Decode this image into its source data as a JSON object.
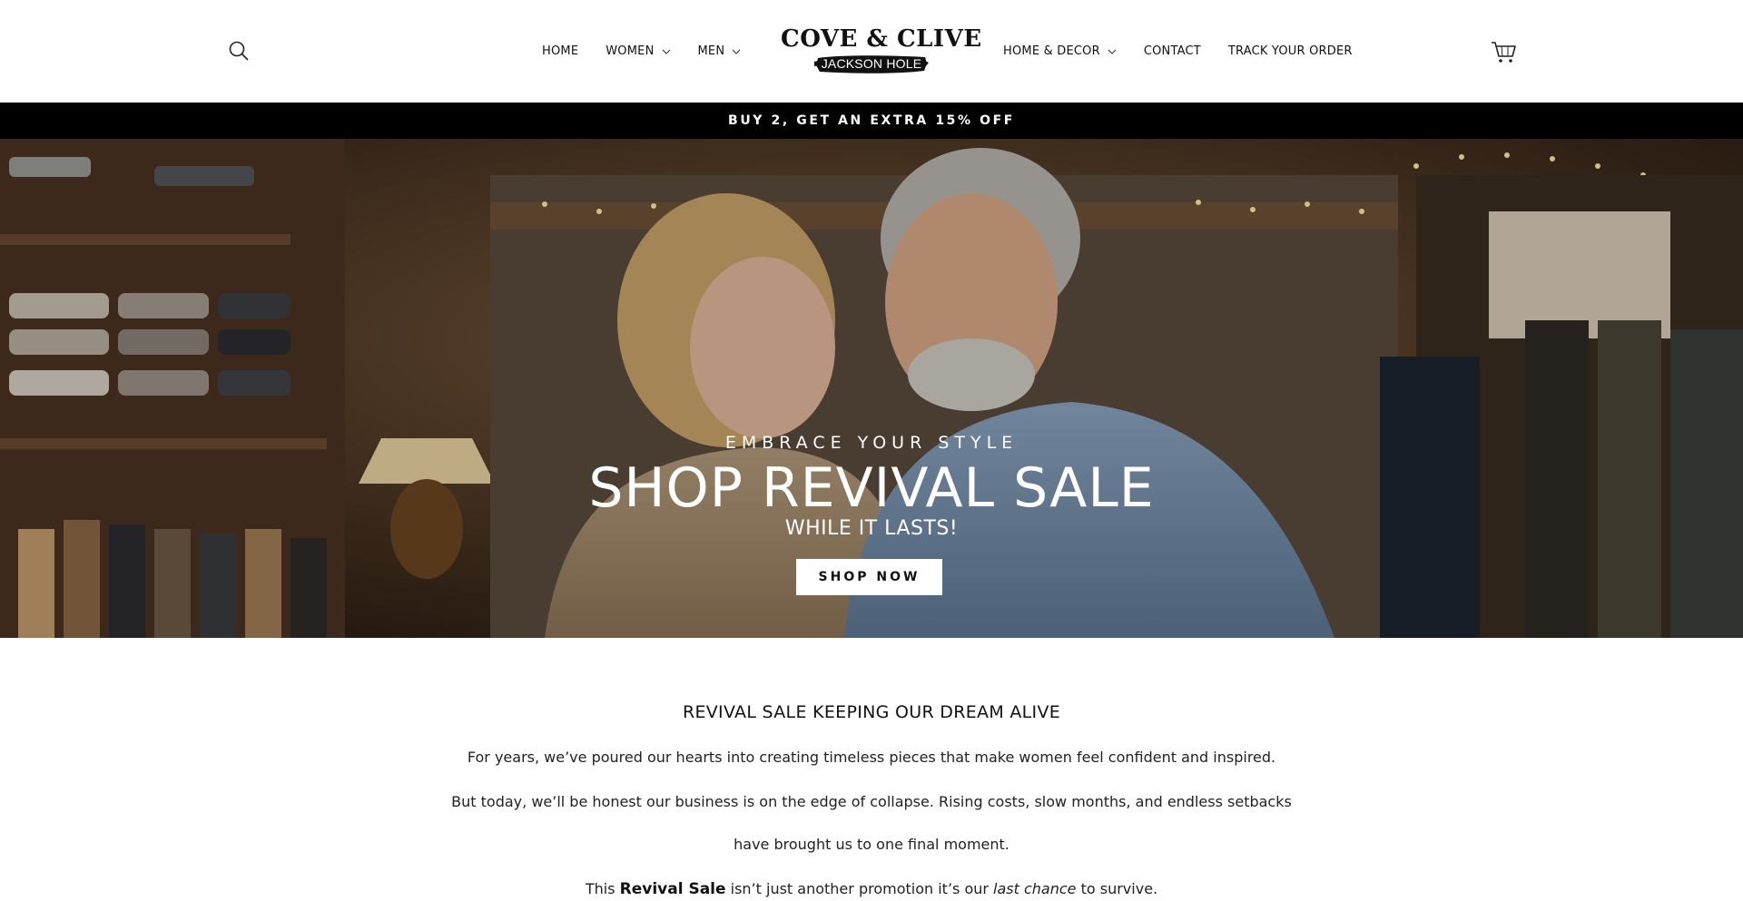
{
  "header": {
    "nav_left": [
      {
        "label": "HOME",
        "has_dropdown": false
      },
      {
        "label": "WOMEN",
        "has_dropdown": true
      },
      {
        "label": "MEN",
        "has_dropdown": true
      }
    ],
    "nav_right": [
      {
        "label": "HOME & DECOR",
        "has_dropdown": true
      },
      {
        "label": "CONTACT",
        "has_dropdown": false
      },
      {
        "label": "TRACK YOUR ORDER",
        "has_dropdown": false
      }
    ],
    "logo": {
      "title": "COVE & CLIVE",
      "subtitle": "JACKSON HOLE"
    },
    "icons": {
      "search": "search-icon",
      "cart": "cart-icon",
      "chevron": "chevron-down-icon"
    }
  },
  "announcement": {
    "text": "BUY 2, GET AN EXTRA 15% OFF"
  },
  "hero": {
    "eyebrow": "EMBRACE YOUR STYLE",
    "title": "SHOP REVIVAL SALE",
    "subtitle": "WHILE IT LASTS!",
    "button_label": "SHOP NOW"
  },
  "content": {
    "title": "REVIVAL SALE KEEPING OUR DREAM ALIVE",
    "p1": "For years, we’ve poured our hearts into creating timeless pieces that make women feel confident and inspired.",
    "p2": "But today, we’ll be honest our business is on the edge of collapse. Rising costs, slow months, and endless setbacks",
    "p3": "have brought us to one final moment.",
    "p4_prefix": "This ",
    "p4_bold": "Revival Sale",
    "p4_mid": " isn’t just another promotion it’s our ",
    "p4_italic": "last chance",
    "p4_suffix": " to survive."
  },
  "colors": {
    "announcement_bg": "#000000",
    "text": "#111111",
    "button_bg": "#ffffff"
  }
}
